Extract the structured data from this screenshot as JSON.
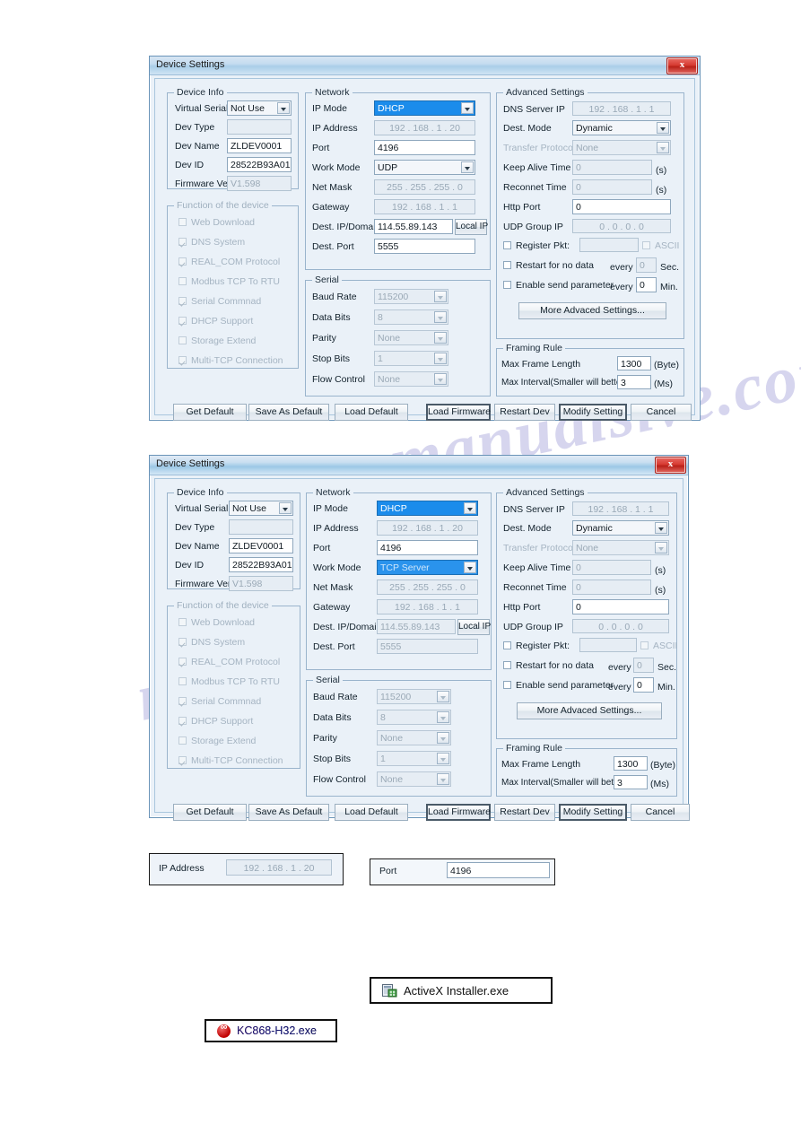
{
  "watermark": {
    "text1": "manualsive.com",
    "text2": "manualslib"
  },
  "dialogs": [
    {
      "title": "Device Settings",
      "close_label": "x",
      "device_info": {
        "legend": "Device Info",
        "rows": [
          {
            "label": "Virtual Serial",
            "value": "Not Use",
            "type": "combo",
            "state": "enabled"
          },
          {
            "label": "Dev Type",
            "value": "",
            "type": "text",
            "state": "readonly"
          },
          {
            "label": "Dev Name",
            "value": "ZLDEV0001",
            "type": "text",
            "state": "enabled"
          },
          {
            "label": "Dev ID",
            "value": "28522B93A015",
            "type": "text",
            "state": "enabled"
          },
          {
            "label": "Firmware Ver",
            "value": "V1.598",
            "type": "text",
            "state": "readonly"
          }
        ]
      },
      "functions": {
        "legend": "Function of the device",
        "items": [
          {
            "label": "Web Download",
            "checked": false
          },
          {
            "label": "DNS System",
            "checked": true
          },
          {
            "label": "REAL_COM Protocol",
            "checked": true
          },
          {
            "label": "Modbus TCP To RTU",
            "checked": false
          },
          {
            "label": "Serial Commnad",
            "checked": true
          },
          {
            "label": "DHCP Support",
            "checked": true
          },
          {
            "label": "Storage Extend",
            "checked": false
          },
          {
            "label": "Multi-TCP Connection",
            "checked": true
          }
        ]
      },
      "network": {
        "legend": "Network",
        "ip_mode_label": "IP Mode",
        "ip_mode_value": "DHCP",
        "ip_mode_state": "selected",
        "ip_address_label": "IP Address",
        "ip_address_value": "192 . 168 . 1 . 20",
        "port_label": "Port",
        "port_value": "4196",
        "port_state": "enabled",
        "work_mode_label": "Work Mode",
        "work_mode_value": "UDP",
        "work_mode_state": "enabled",
        "net_mask_label": "Net Mask",
        "net_mask_value": "255 . 255 . 255 . 0",
        "gateway_label": "Gateway",
        "gateway_value": "192 . 168 . 1 . 1",
        "dest_ip_label": "Dest. IP/Domain",
        "dest_ip_value": "114.55.89.143",
        "dest_ip_state": "enabled",
        "local_ip_label": "Local IP",
        "dest_port_label": "Dest. Port",
        "dest_port_value": "5555",
        "dest_port_state": "enabled"
      },
      "serial": {
        "legend": "Serial",
        "rows": [
          {
            "label": "Baud Rate",
            "value": "115200"
          },
          {
            "label": "Data Bits",
            "value": "8"
          },
          {
            "label": "Parity",
            "value": "None"
          },
          {
            "label": "Stop Bits",
            "value": "1"
          },
          {
            "label": "Flow Control",
            "value": "None"
          }
        ]
      },
      "advanced": {
        "legend": "Advanced Settings",
        "dns_label": "DNS Server IP",
        "dns_value": "192 . 168 . 1 . 1",
        "dest_mode_label": "Dest. Mode",
        "dest_mode_value": "Dynamic",
        "transfer_label": "Transfer Protocol",
        "transfer_value": "None",
        "keep_alive_label": "Keep Alive Time",
        "keep_alive_value": "0",
        "keep_alive_unit": "(s)",
        "reconnet_label": "Reconnet Time",
        "reconnet_value": "0",
        "reconnet_unit": "(s)",
        "http_port_label": "Http Port",
        "http_port_value": "0",
        "udp_group_label": "UDP Group IP",
        "udp_group_value": "0 . 0 . 0 . 0",
        "register_label": "Register Pkt:",
        "register_value": "",
        "register_checked": false,
        "ascii_label": "ASCII",
        "ascii_checked": false,
        "restart_label": "Restart for no data",
        "restart_checked": false,
        "restart_every": "every",
        "restart_value": "0",
        "restart_unit": "Sec.",
        "send_param_label": "Enable send parameter",
        "send_param_checked": false,
        "send_param_every": "every",
        "send_param_value": "0",
        "send_param_unit": "Min.",
        "more_button": "More Advaced Settings..."
      },
      "framing": {
        "legend": "Framing Rule",
        "max_frame_label": "Max Frame Length",
        "max_frame_value": "1300",
        "max_frame_unit": "(Byte)",
        "max_interval_label": "Max Interval(Smaller will better)",
        "max_interval_value": "3",
        "max_interval_unit": "(Ms)"
      },
      "buttons": {
        "get_default": "Get Default",
        "save_as_default": "Save As Default",
        "load_default": "Load Default",
        "load_firmware": "Load Firmware",
        "restart_dev": "Restart Dev",
        "modify_setting": "Modify Setting",
        "cancel": "Cancel"
      }
    },
    {
      "title": "Device Settings",
      "close_label": "x",
      "device_info": {
        "legend": "Device Info",
        "rows": [
          {
            "label": "Virtual Serial",
            "value": "Not Use",
            "type": "combo",
            "state": "enabled"
          },
          {
            "label": "Dev Type",
            "value": "",
            "type": "text",
            "state": "readonly"
          },
          {
            "label": "Dev Name",
            "value": "ZLDEV0001",
            "type": "text",
            "state": "enabled"
          },
          {
            "label": "Dev ID",
            "value": "28522B93A015",
            "type": "text",
            "state": "enabled"
          },
          {
            "label": "Firmware Ver",
            "value": "V1.598",
            "type": "text",
            "state": "readonly"
          }
        ]
      },
      "functions": {
        "legend": "Function of the device",
        "items": [
          {
            "label": "Web Download",
            "checked": false
          },
          {
            "label": "DNS System",
            "checked": true
          },
          {
            "label": "REAL_COM Protocol",
            "checked": true
          },
          {
            "label": "Modbus TCP To RTU",
            "checked": false
          },
          {
            "label": "Serial Commnad",
            "checked": true
          },
          {
            "label": "DHCP Support",
            "checked": true
          },
          {
            "label": "Storage Extend",
            "checked": false
          },
          {
            "label": "Multi-TCP Connection",
            "checked": true
          }
        ]
      },
      "network": {
        "legend": "Network",
        "ip_mode_label": "IP Mode",
        "ip_mode_value": "DHCP",
        "ip_mode_state": "selected",
        "ip_address_label": "IP Address",
        "ip_address_value": "192 . 168 . 1 . 20",
        "port_label": "Port",
        "port_value": "4196",
        "port_state": "enabled",
        "work_mode_label": "Work Mode",
        "work_mode_value": "TCP Server",
        "work_mode_state": "selected",
        "net_mask_label": "Net Mask",
        "net_mask_value": "255 . 255 . 255 . 0",
        "gateway_label": "Gateway",
        "gateway_value": "192 . 168 . 1 . 1",
        "dest_ip_label": "Dest. IP/Domain",
        "dest_ip_value": "114.55.89.143",
        "dest_ip_state": "readonly",
        "local_ip_label": "Local IP",
        "dest_port_label": "Dest. Port",
        "dest_port_value": "5555",
        "dest_port_state": "readonly"
      },
      "serial": {
        "legend": "Serial",
        "rows": [
          {
            "label": "Baud Rate",
            "value": "115200"
          },
          {
            "label": "Data Bits",
            "value": "8"
          },
          {
            "label": "Parity",
            "value": "None"
          },
          {
            "label": "Stop Bits",
            "value": "1"
          },
          {
            "label": "Flow Control",
            "value": "None"
          }
        ]
      },
      "advanced": {
        "legend": "Advanced Settings",
        "dns_label": "DNS Server IP",
        "dns_value": "192 . 168 . 1 . 1",
        "dest_mode_label": "Dest. Mode",
        "dest_mode_value": "Dynamic",
        "transfer_label": "Transfer Protocol",
        "transfer_value": "None",
        "keep_alive_label": "Keep Alive Time",
        "keep_alive_value": "0",
        "keep_alive_unit": "(s)",
        "reconnet_label": "Reconnet Time",
        "reconnet_value": "0",
        "reconnet_unit": "(s)",
        "http_port_label": "Http Port",
        "http_port_value": "0",
        "udp_group_label": "UDP Group IP",
        "udp_group_value": "0 . 0 . 0 . 0",
        "register_label": "Register Pkt:",
        "register_value": "",
        "register_checked": false,
        "ascii_label": "ASCII",
        "ascii_checked": false,
        "restart_label": "Restart for no data",
        "restart_checked": false,
        "restart_every": "every",
        "restart_value": "0",
        "restart_unit": "Sec.",
        "send_param_label": "Enable send parameter",
        "send_param_checked": false,
        "send_param_every": "every",
        "send_param_value": "0",
        "send_param_unit": "Min.",
        "more_button": "More Advaced Settings..."
      },
      "framing": {
        "legend": "Framing Rule",
        "max_frame_label": "Max Frame Length",
        "max_frame_value": "1300",
        "max_frame_unit": "(Byte)",
        "max_interval_label": "Max Interval(Smaller will better)",
        "max_interval_value": "3",
        "max_interval_unit": "(Ms)"
      },
      "buttons": {
        "get_default": "Get Default",
        "save_as_default": "Save As Default",
        "load_default": "Load Default",
        "load_firmware": "Load Firmware",
        "restart_dev": "Restart Dev",
        "modify_setting": "Modify Setting",
        "cancel": "Cancel"
      }
    }
  ],
  "callouts": {
    "ip_address": {
      "label": "IP Address",
      "value": "192 . 168 . 1 . 20"
    },
    "port": {
      "label": "Port",
      "value": "4196"
    }
  },
  "files": {
    "activex": {
      "name": "ActiveX Installer.exe",
      "icon": "installer-icon"
    },
    "kc868": {
      "name": "KC868-H32.exe",
      "icon": "kc868-app-icon"
    }
  }
}
